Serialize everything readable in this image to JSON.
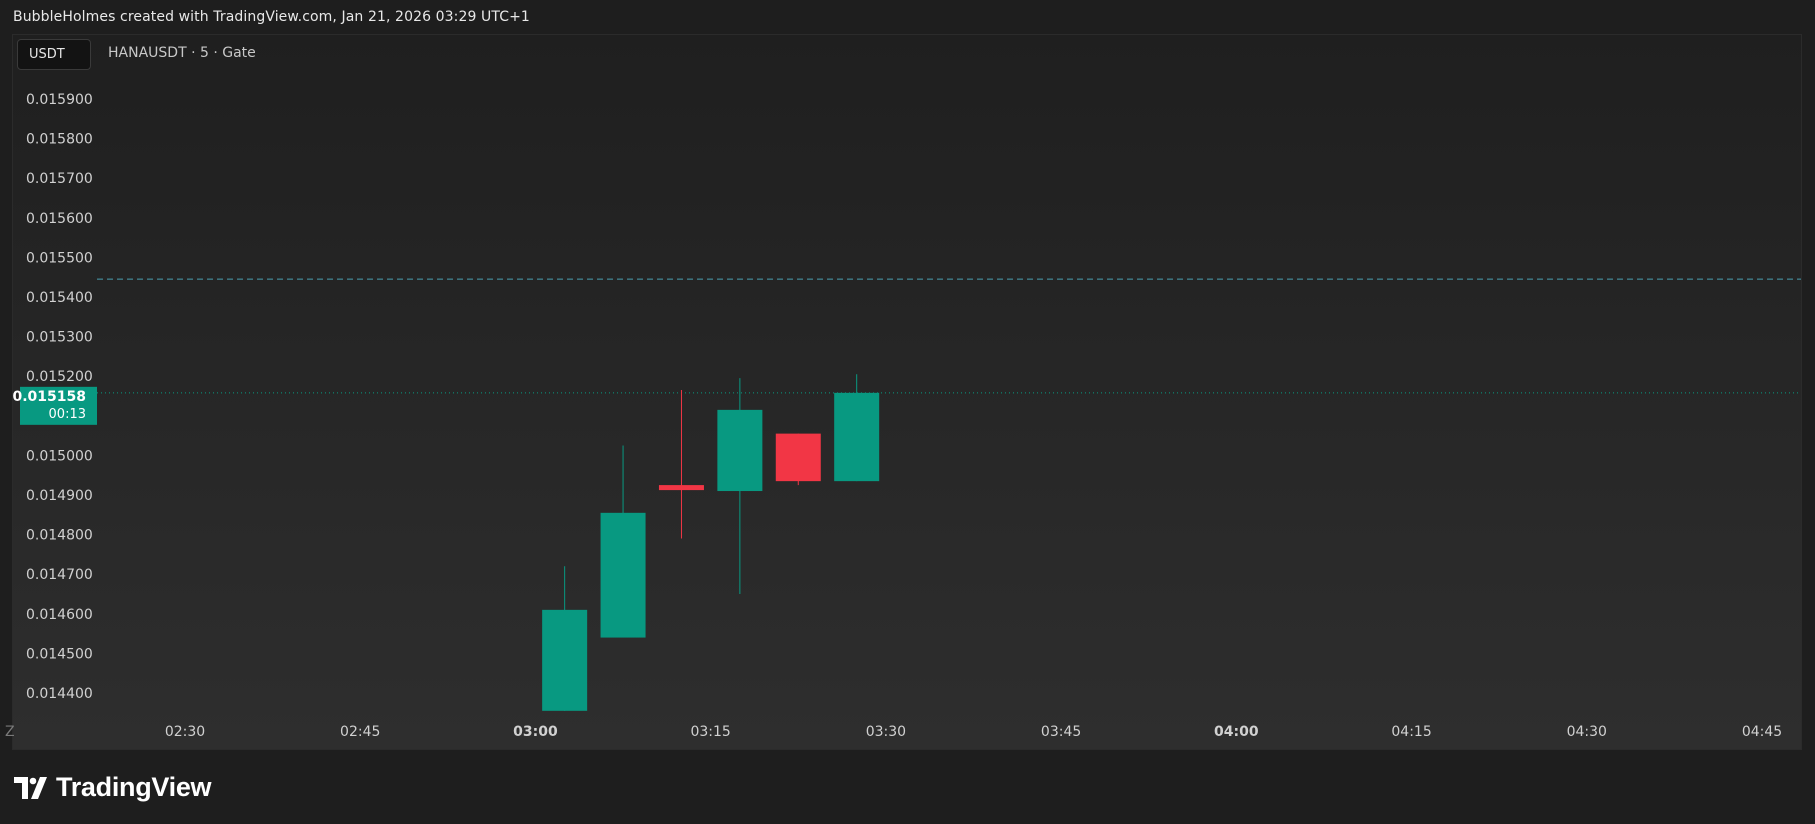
{
  "header": {
    "credit": "BubbleHolmes created with TradingView.com, Jan 21, 2026 03:29 UTC+1"
  },
  "legend": {
    "unit": "USDT",
    "symbol_info": "HANAUSDT · 5 · Gate"
  },
  "brand": {
    "name": "TradingView"
  },
  "colors": {
    "up": "#089981",
    "down": "#f23645",
    "axis_text": "#d1d1d1",
    "dashed_line": "#4a9fb0"
  },
  "chart_data": {
    "type": "candlestick",
    "y_ticks": [
      "0.015900",
      "0.015800",
      "0.015700",
      "0.015600",
      "0.015500",
      "0.015400",
      "0.015300",
      "0.015200",
      "0.015000",
      "0.014900",
      "0.014800",
      "0.014700",
      "0.014600",
      "0.014500",
      "0.014400"
    ],
    "y_range": [
      0.01435,
      0.01599
    ],
    "x_labels": [
      {
        "label": "Z",
        "time": "02:15",
        "bold": false
      },
      {
        "label": "02:30",
        "time": "02:30",
        "bold": false
      },
      {
        "label": "02:45",
        "time": "02:45",
        "bold": false
      },
      {
        "label": "03:00",
        "time": "03:00",
        "bold": true
      },
      {
        "label": "03:15",
        "time": "03:15",
        "bold": false
      },
      {
        "label": "03:30",
        "time": "03:30",
        "bold": false
      },
      {
        "label": "03:45",
        "time": "03:45",
        "bold": false
      },
      {
        "label": "04:00",
        "time": "04:00",
        "bold": true
      },
      {
        "label": "04:15",
        "time": "04:15",
        "bold": false
      },
      {
        "label": "04:30",
        "time": "04:30",
        "bold": false
      },
      {
        "label": "04:45",
        "time": "04:45",
        "bold": false
      }
    ],
    "candles": [
      {
        "time": "03:00",
        "open": 0.014355,
        "high": 0.01472,
        "low": 0.014355,
        "close": 0.01461
      },
      {
        "time": "03:05",
        "open": 0.01454,
        "high": 0.015025,
        "low": 0.01454,
        "close": 0.014855
      },
      {
        "time": "03:10",
        "open": 0.014925,
        "high": 0.015165,
        "low": 0.01479,
        "close": 0.014915
      },
      {
        "time": "03:15",
        "open": 0.01491,
        "high": 0.015195,
        "low": 0.01465,
        "close": 0.015115
      },
      {
        "time": "03:20",
        "open": 0.015055,
        "high": 0.015055,
        "low": 0.014925,
        "close": 0.014935
      },
      {
        "time": "03:25",
        "open": 0.014935,
        "high": 0.015205,
        "low": 0.014935,
        "close": 0.015158
      }
    ],
    "dashed_level": 0.015445,
    "current_price": {
      "value": "0.015158",
      "countdown": "00:13"
    }
  }
}
